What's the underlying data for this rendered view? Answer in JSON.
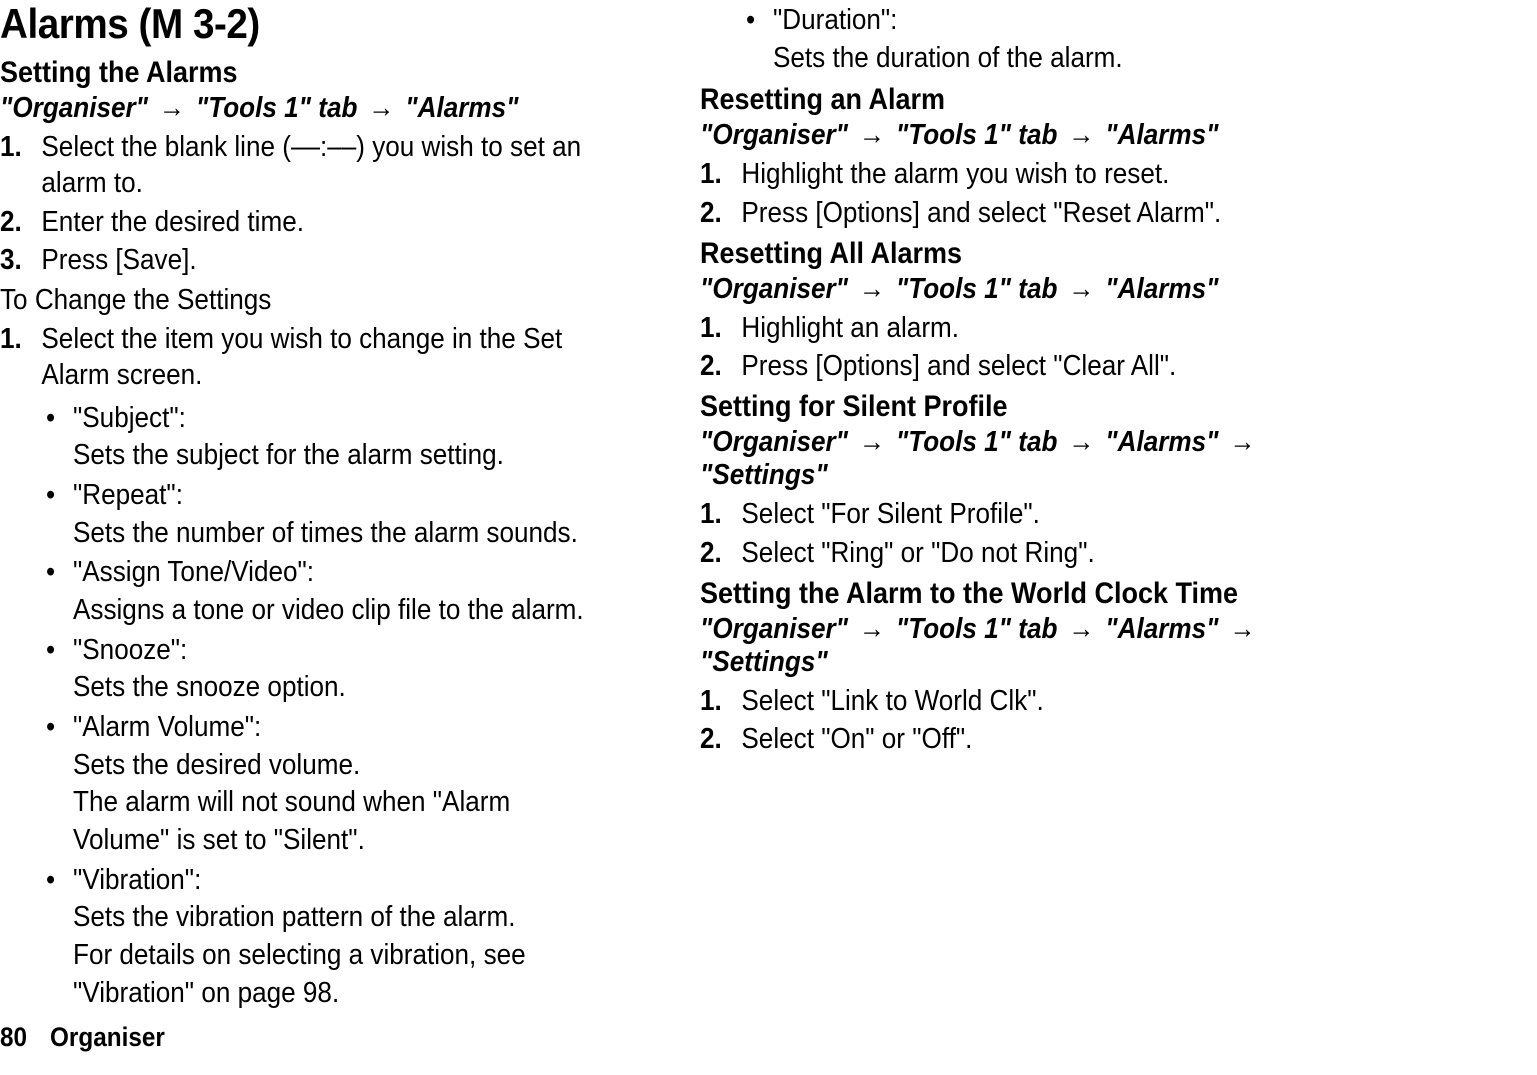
{
  "title": "Alarms",
  "title_code": "(M 3-2)",
  "arrow": "→",
  "footer": {
    "page": "80",
    "section": "Organiser"
  },
  "left": {
    "setting": {
      "heading": "Setting the Alarms",
      "path": [
        "\"Organiser\"",
        "\"Tools 1\" tab",
        "\"Alarms\""
      ],
      "steps": [
        "Select the blank line (––:––) you wish to set an alarm to.",
        "Enter the desired time.",
        "Press [Save]."
      ]
    },
    "change": {
      "heading": "To Change the Settings",
      "steps": [
        "Select the item you wish to change in the Set Alarm screen."
      ],
      "items": [
        {
          "term": "\"Subject\":",
          "desc": "Sets the subject for the alarm setting."
        },
        {
          "term": "\"Repeat\":",
          "desc": "Sets the number of times the alarm sounds."
        },
        {
          "term": "\"Assign Tone/Video\":",
          "desc": "Assigns a tone or video clip file to the alarm."
        },
        {
          "term": "\"Snooze\":",
          "desc": "Sets the snooze option."
        },
        {
          "term": "\"Alarm Volume\":",
          "desc": "Sets the desired volume.\nThe alarm will not sound when \"Alarm Volume\" is set to \"Silent\"."
        },
        {
          "term": "\"Vibration\":",
          "desc": "Sets the vibration pattern of the alarm.\nFor details on selecting a vibration, see \"Vibration\" on page 98."
        }
      ]
    }
  },
  "right": {
    "cont_items": [
      {
        "term": "\"Duration\":",
        "desc": "Sets the duration of the alarm."
      }
    ],
    "reset_one": {
      "heading": "Resetting an Alarm",
      "path": [
        "\"Organiser\"",
        "\"Tools 1\" tab",
        "\"Alarms\""
      ],
      "steps": [
        "Highlight the alarm you wish to reset.",
        "Press [Options] and select \"Reset Alarm\"."
      ]
    },
    "reset_all": {
      "heading": "Resetting All Alarms",
      "path": [
        "\"Organiser\"",
        "\"Tools 1\" tab",
        "\"Alarms\""
      ],
      "steps": [
        "Highlight an alarm.",
        "Press [Options] and select \"Clear All\"."
      ]
    },
    "silent": {
      "heading": "Setting for Silent Profile",
      "path": [
        "\"Organiser\"",
        "\"Tools 1\" tab",
        "\"Alarms\"",
        "\"Settings\""
      ],
      "steps": [
        "Select \"For Silent Profile\".",
        "Select \"Ring\" or \"Do not Ring\"."
      ]
    },
    "world": {
      "heading": "Setting the Alarm to the World Clock Time",
      "path": [
        "\"Organiser\"",
        "\"Tools 1\" tab",
        "\"Alarms\"",
        "\"Settings\""
      ],
      "steps": [
        "Select \"Link to World Clk\".",
        "Select \"On\" or \"Off\"."
      ]
    }
  }
}
